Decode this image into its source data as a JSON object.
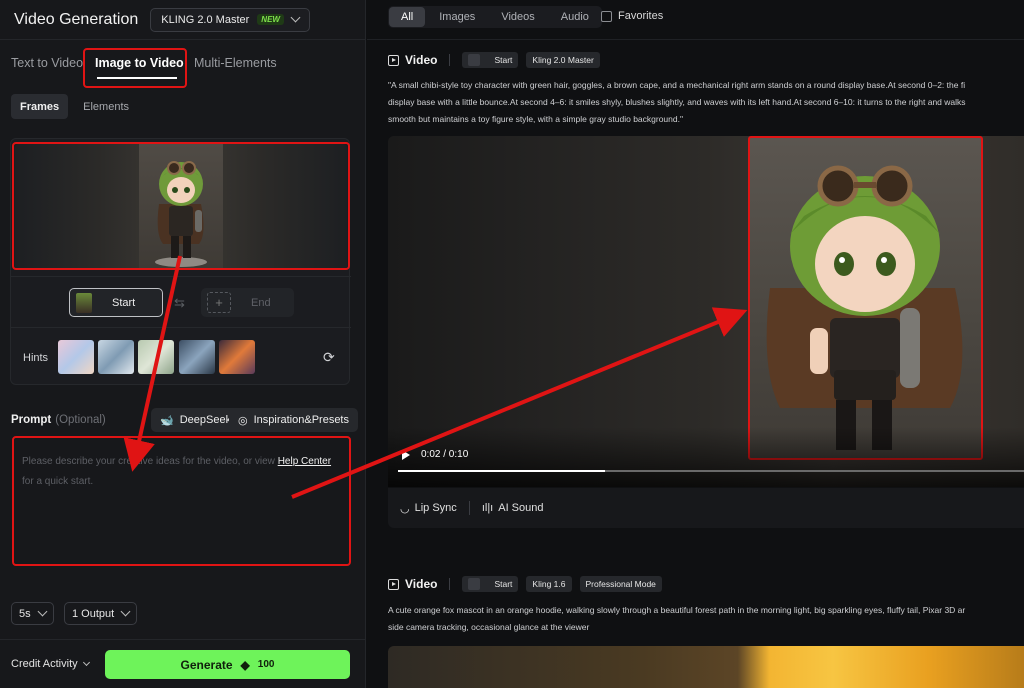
{
  "app": {
    "title": "Video Generation",
    "model": "KLING 2.0 Master",
    "model_badge": "NEW"
  },
  "mode_tabs": [
    "Text to Video",
    "Image to Video",
    "Multi-Elements"
  ],
  "sub_tabs": [
    "Frames",
    "Elements"
  ],
  "frames": {
    "start_label": "Start",
    "end_label": "End"
  },
  "hints": {
    "label": "Hints"
  },
  "prompt": {
    "label": "Prompt",
    "optional": "(Optional)",
    "deepseek_label": "DeepSeek",
    "inspiration_label": "Inspiration&Presets",
    "placeholder_part1": "Please describe your creative ideas for the video, or view",
    "help_link": "Help Center",
    "placeholder_part2": "for a quick start."
  },
  "settings": {
    "duration": "5s",
    "outputs": "1 Output"
  },
  "footer": {
    "credit_label": "Credit Activity",
    "generate_label": "Generate",
    "generate_cost": "100"
  },
  "filters": {
    "tabs": [
      "All",
      "Images",
      "Videos",
      "Audio"
    ],
    "active": "All",
    "favorites_label": "Favorites"
  },
  "videos": [
    {
      "title": "Video",
      "tags": [
        "Start",
        "Kling 2.0 Master"
      ],
      "description_lines": [
        "\"A small chibi-style toy character with green hair, goggles, a brown cape, and a mechanical right arm stands on a round display base.At second 0–2: the fi",
        "display base with a little bounce.At second 4–6: it smiles shyly, blushes slightly, and waves with its left hand.At second 6–10: it turns to the right and walks",
        "smooth but maintains a toy figure style, with a simple gray studio background.\""
      ],
      "time": "0:02 / 0:10",
      "progress": 0.33,
      "actions": [
        "Lip Sync",
        "AI Sound"
      ]
    },
    {
      "title": "Video",
      "tags": [
        "Start",
        "Kling 1.6",
        "Professional Mode"
      ],
      "description_lines": [
        "A cute orange fox mascot in an orange hoodie, walking slowly through a beautiful forest path in the morning light, big sparkling eyes, fluffy tail, Pixar 3D ar",
        "side camera tracking, occasional glance at the viewer"
      ]
    }
  ],
  "colors": {
    "accent_green": "#6ef35a",
    "annotation_red": "#e01414"
  }
}
